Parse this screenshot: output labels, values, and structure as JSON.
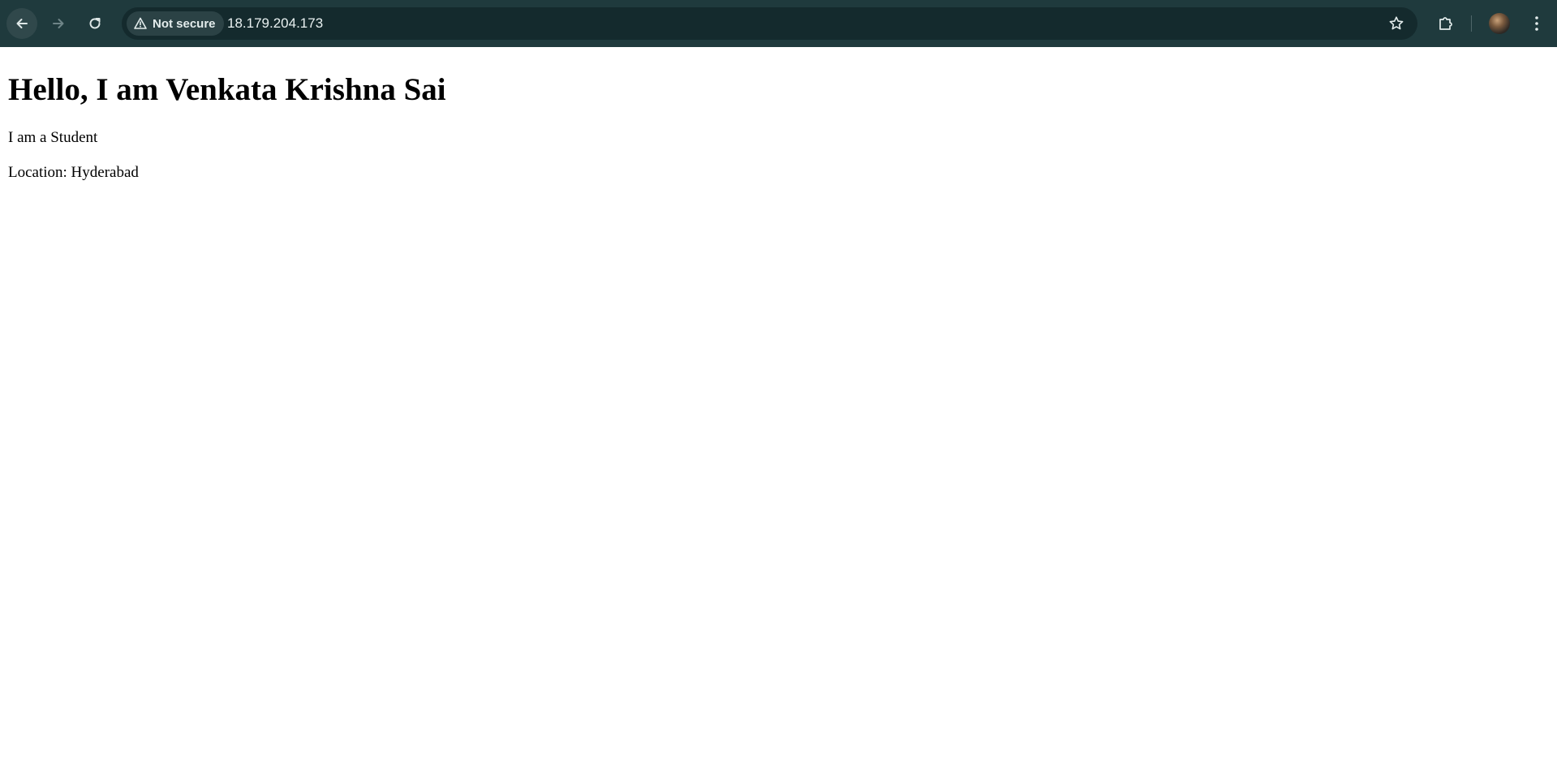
{
  "browser": {
    "security_label": "Not secure",
    "url": "18.179.204.173",
    "icons": {
      "back": "arrow-left-icon",
      "forward": "arrow-right-icon",
      "reload": "reload-icon",
      "security": "warning-triangle-icon",
      "bookmark": "star-icon",
      "extensions": "puzzle-icon",
      "profile": "avatar",
      "menu": "kebab-menu-icon"
    },
    "colors": {
      "toolbar": "#1f3a3d",
      "omnibox": "#142a2d",
      "chip": "#2b4245",
      "text": "#e8f0f0"
    }
  },
  "page": {
    "heading": "Hello, I am Venkata Krishna Sai",
    "role_text": "I am a Student",
    "location_text": "Location: Hyderabad"
  }
}
